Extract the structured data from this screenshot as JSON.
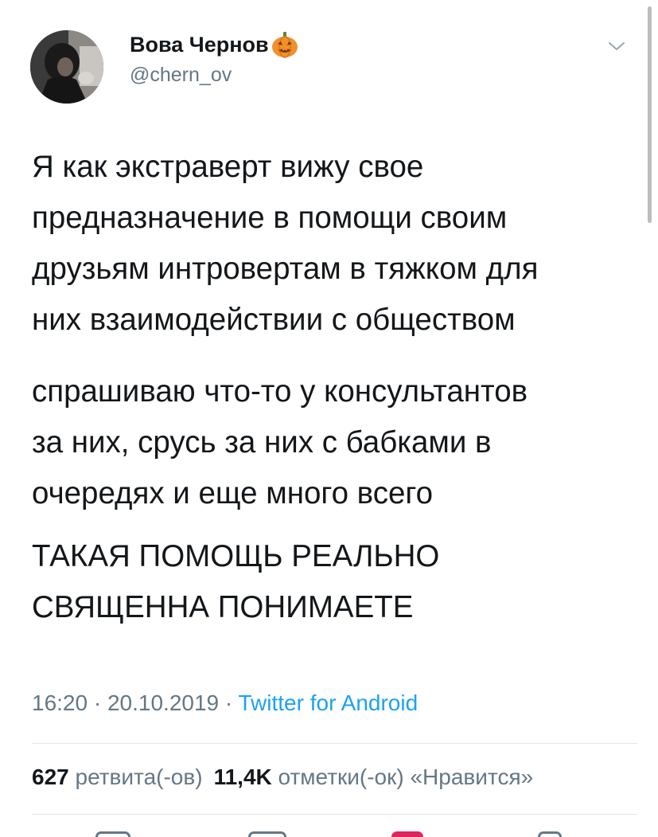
{
  "user": {
    "display_name": "Вова Чернов",
    "handle": "@chern_ov",
    "avatar_icon": "user-avatar-photo",
    "badge_icon": "jack-o-lantern-emoji"
  },
  "tweet": {
    "paragraphs": [
      {
        "lines": [
          "Я как экстраверт вижу свое",
          "предназначение в помощи своим",
          "друзьям интровертам в тяжком для",
          "них взаимодействии с обществом"
        ]
      },
      {
        "lines": [
          "спрашиваю что-то у консультантов",
          "за них, срусь за них с бабками в",
          "очередях и еще много всего"
        ]
      },
      {
        "lines": [
          "ТАКАЯ ПОМОЩЬ РЕАЛЬНО",
          "СВЯЩЕННА ПОНИМАЕТЕ"
        ]
      }
    ]
  },
  "meta": {
    "time": "16:20",
    "separator": " · ",
    "date": "20.10.2019",
    "source": "Twitter for Android"
  },
  "stats": {
    "retweets_count": "627",
    "retweets_label": "ретвита(-ов)",
    "likes_count": "11,4K",
    "likes_label": "отметки(-ок) «Нравится»"
  },
  "colors": {
    "text": "#14171a",
    "secondary": "#657786",
    "link": "#1da1f2",
    "divider": "#e1e8ed",
    "like": "#e0245e"
  }
}
